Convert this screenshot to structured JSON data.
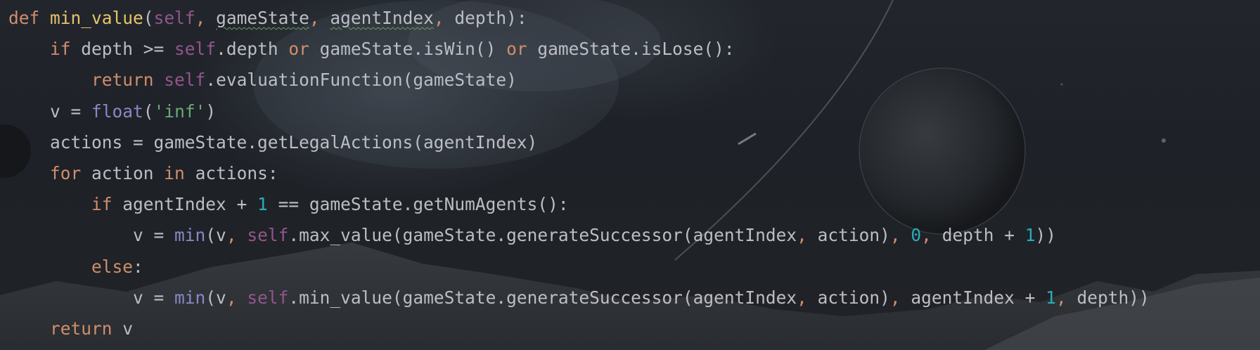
{
  "editor": {
    "language": "python",
    "colors": {
      "background": "#1d2026",
      "default_text": "#bcbec4",
      "keyword": "#cf8e6d",
      "function_name": "#e8c46a",
      "self": "#94558d",
      "builtin": "#8888c6",
      "string": "#6aab73",
      "number": "#2aacb8"
    },
    "lines": [
      {
        "indent": "",
        "tokens": [
          {
            "t": "def",
            "c": "kw"
          },
          {
            "t": " ",
            "c": ""
          },
          {
            "t": "min_value",
            "c": "fname"
          },
          {
            "t": "(",
            "c": ""
          },
          {
            "t": "self",
            "c": "slf"
          },
          {
            "t": ", ",
            "c": "kw"
          },
          {
            "t": "gameState",
            "c": "wavy"
          },
          {
            "t": ", ",
            "c": "kw"
          },
          {
            "t": "agentIndex",
            "c": "wavy"
          },
          {
            "t": ", ",
            "c": "kw"
          },
          {
            "t": "depth",
            "c": ""
          },
          {
            "t": "):",
            "c": ""
          }
        ]
      },
      {
        "indent": "    ",
        "tokens": [
          {
            "t": "if",
            "c": "kw"
          },
          {
            "t": " depth >= ",
            "c": ""
          },
          {
            "t": "self",
            "c": "slf"
          },
          {
            "t": ".depth ",
            "c": ""
          },
          {
            "t": "or",
            "c": "kw"
          },
          {
            "t": " gameState.isWin() ",
            "c": ""
          },
          {
            "t": "or",
            "c": "kw"
          },
          {
            "t": " gameState.isLose():",
            "c": ""
          }
        ]
      },
      {
        "indent": "        ",
        "tokens": [
          {
            "t": "return",
            "c": "kw"
          },
          {
            "t": " ",
            "c": ""
          },
          {
            "t": "self",
            "c": "slf"
          },
          {
            "t": ".evaluationFunction(gameState)",
            "c": ""
          }
        ]
      },
      {
        "indent": "    ",
        "tokens": [
          {
            "t": "v = ",
            "c": ""
          },
          {
            "t": "float",
            "c": "bi"
          },
          {
            "t": "(",
            "c": ""
          },
          {
            "t": "'inf'",
            "c": "str"
          },
          {
            "t": ")",
            "c": ""
          }
        ]
      },
      {
        "indent": "    ",
        "tokens": [
          {
            "t": "actions = gameState.getLegalActions(agentIndex)",
            "c": ""
          }
        ]
      },
      {
        "indent": "    ",
        "tokens": [
          {
            "t": "for",
            "c": "kw"
          },
          {
            "t": " action ",
            "c": ""
          },
          {
            "t": "in",
            "c": "kw"
          },
          {
            "t": " actions:",
            "c": ""
          }
        ]
      },
      {
        "indent": "        ",
        "tokens": [
          {
            "t": "if",
            "c": "kw"
          },
          {
            "t": " agentIndex + ",
            "c": ""
          },
          {
            "t": "1",
            "c": "num"
          },
          {
            "t": " == gameState.getNumAgents():",
            "c": ""
          }
        ]
      },
      {
        "indent": "            ",
        "tokens": [
          {
            "t": "v = ",
            "c": ""
          },
          {
            "t": "min",
            "c": "bi"
          },
          {
            "t": "(v",
            "c": ""
          },
          {
            "t": ", ",
            "c": "kw"
          },
          {
            "t": "self",
            "c": "slf"
          },
          {
            "t": ".max_value(gameState.generateSuccessor(agentIndex",
            "c": ""
          },
          {
            "t": ", ",
            "c": "kw"
          },
          {
            "t": "action)",
            "c": ""
          },
          {
            "t": ", ",
            "c": "kw"
          },
          {
            "t": "0",
            "c": "num"
          },
          {
            "t": ", ",
            "c": "kw"
          },
          {
            "t": "depth + ",
            "c": ""
          },
          {
            "t": "1",
            "c": "num"
          },
          {
            "t": "))",
            "c": ""
          }
        ]
      },
      {
        "indent": "        ",
        "tokens": [
          {
            "t": "else",
            "c": "kw"
          },
          {
            "t": ":",
            "c": ""
          }
        ]
      },
      {
        "indent": "            ",
        "tokens": [
          {
            "t": "v = ",
            "c": ""
          },
          {
            "t": "min",
            "c": "bi"
          },
          {
            "t": "(v",
            "c": ""
          },
          {
            "t": ", ",
            "c": "kw"
          },
          {
            "t": "self",
            "c": "slf"
          },
          {
            "t": ".min_value(gameState.generateSuccessor(agentIndex",
            "c": ""
          },
          {
            "t": ", ",
            "c": "kw"
          },
          {
            "t": "action)",
            "c": ""
          },
          {
            "t": ", ",
            "c": "kw"
          },
          {
            "t": "agentIndex + ",
            "c": ""
          },
          {
            "t": "1",
            "c": "num"
          },
          {
            "t": ", ",
            "c": "kw"
          },
          {
            "t": "depth))",
            "c": ""
          }
        ]
      },
      {
        "indent": "    ",
        "tokens": [
          {
            "t": "return",
            "c": "kw"
          },
          {
            "t": " v",
            "c": ""
          }
        ]
      }
    ]
  }
}
